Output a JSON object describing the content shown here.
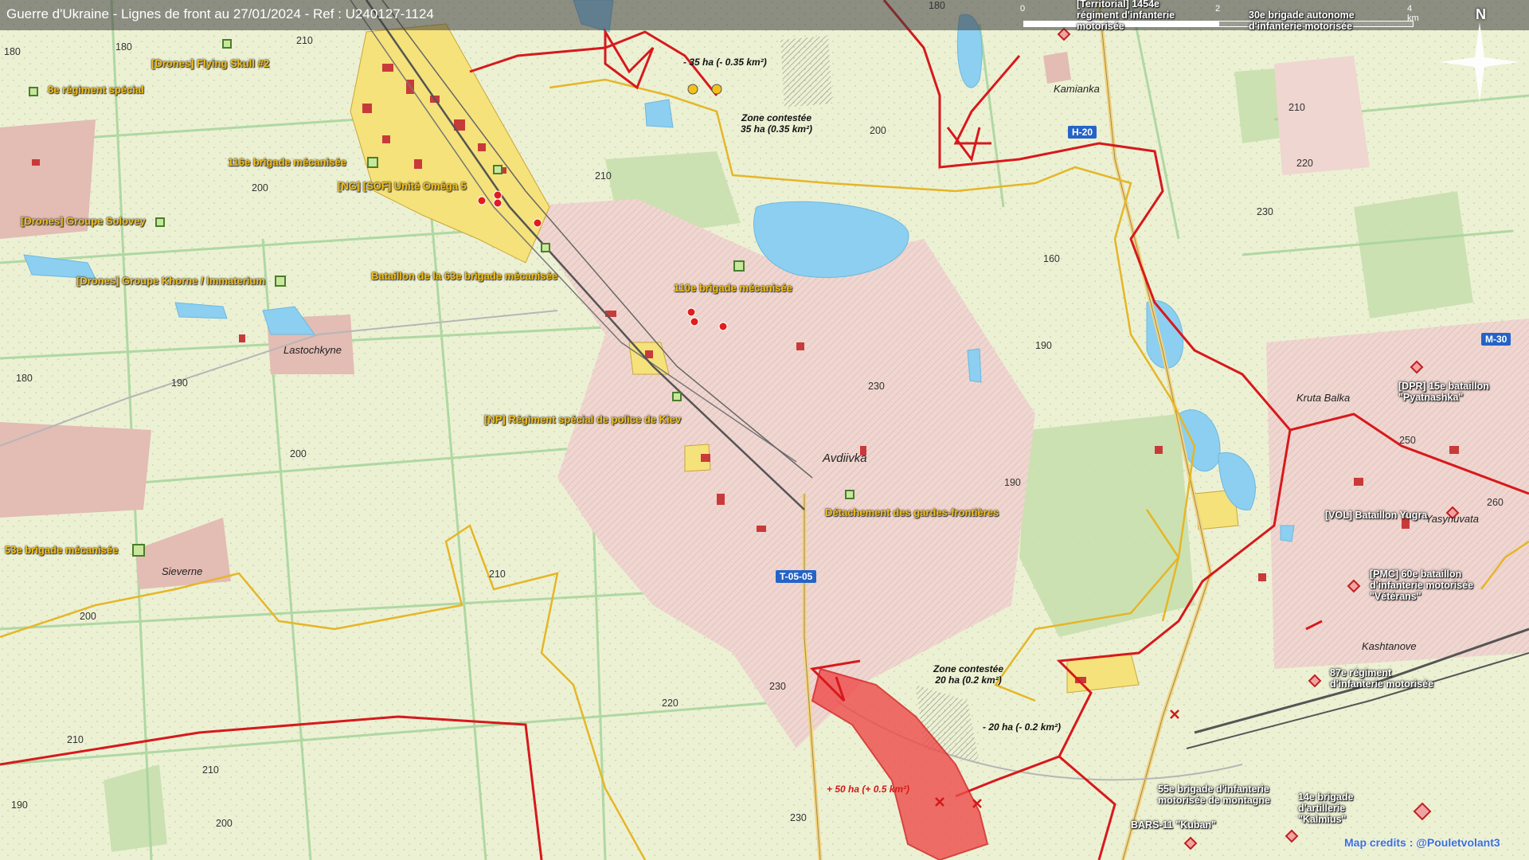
{
  "title": "Guerre d'Ukraine - Lignes de front au 27/01/2024 - Ref : U240127-1124",
  "scale": {
    "t0": "0",
    "t2": "2",
    "t4": "4 km"
  },
  "north": "N",
  "colors": {
    "front_line": "#d7191c",
    "contested_border": "#e5b627",
    "gain_fill": "#ef3b3b",
    "urban_yellow": "#f4e37a",
    "urban_pink": "#e9c9c2",
    "water": "#7cc8ee",
    "road_sign": "#2563c7"
  },
  "units": [
    "[Drones] Flying Skull #2",
    "8e régiment spécial",
    "116e brigade mécanisée",
    "[NG] [SOF] Unité Oméga 5",
    "[Drones] Groupe Solovey",
    "[Drones] Groupe Khorne / Immaterium",
    "Bataillon de la 63e brigade mécanisée",
    "110e brigade mécanisée",
    "[NP] Régiment spécial de police de Kiev",
    "Détachement des gardes-frontières",
    "53e brigade mécanisée"
  ],
  "enemy_units": [
    "[Territorial] 1454e régiment d'infanterie motorisée",
    "30e brigade autonome d'infanterie motorisée",
    "[DPR] 15e bataillon \"Pyatnashka\"",
    "[VOL] Bataillon Yugra",
    "[PMC] 60e bataillon d'infanterie motorisée \"Vétérans\"",
    "87e régiment d'infanterie motorisée",
    "55e brigade d'infanterie motorisée de montagne",
    "14e brigade d'artillerie \"Kalmius\"",
    "BARS-11 \"Kuban\""
  ],
  "places": [
    "Kamianka",
    "Lastochkyne",
    "Avdiivka",
    "Kruta Balka",
    "Yasynuvata",
    "Kashtanove",
    "Sieverne"
  ],
  "roads": [
    "H-20",
    "M-30",
    "T-05-05"
  ],
  "zones": {
    "z1": "- 35 ha (- 0.35 km²)",
    "z2a": "Zone contestée",
    "z2b": "35 ha (0.35 km²)",
    "z3a": "Zone contestée",
    "z3b": "20 ha (0.2 km²)",
    "z4": "- 20 ha (- 0.2 km²)",
    "z5": "+ 50 ha (+ 0.5 km²)"
  },
  "elevations": [
    "180",
    "190",
    "210",
    "200",
    "220",
    "230",
    "160",
    "250",
    "260",
    "190",
    "200",
    "210",
    "220",
    "230",
    "200",
    "210",
    "190",
    "180",
    "200",
    "190",
    "210",
    "200",
    "230",
    "190",
    "260",
    "180"
  ],
  "credits": "Map credits : @Pouletvolant3"
}
